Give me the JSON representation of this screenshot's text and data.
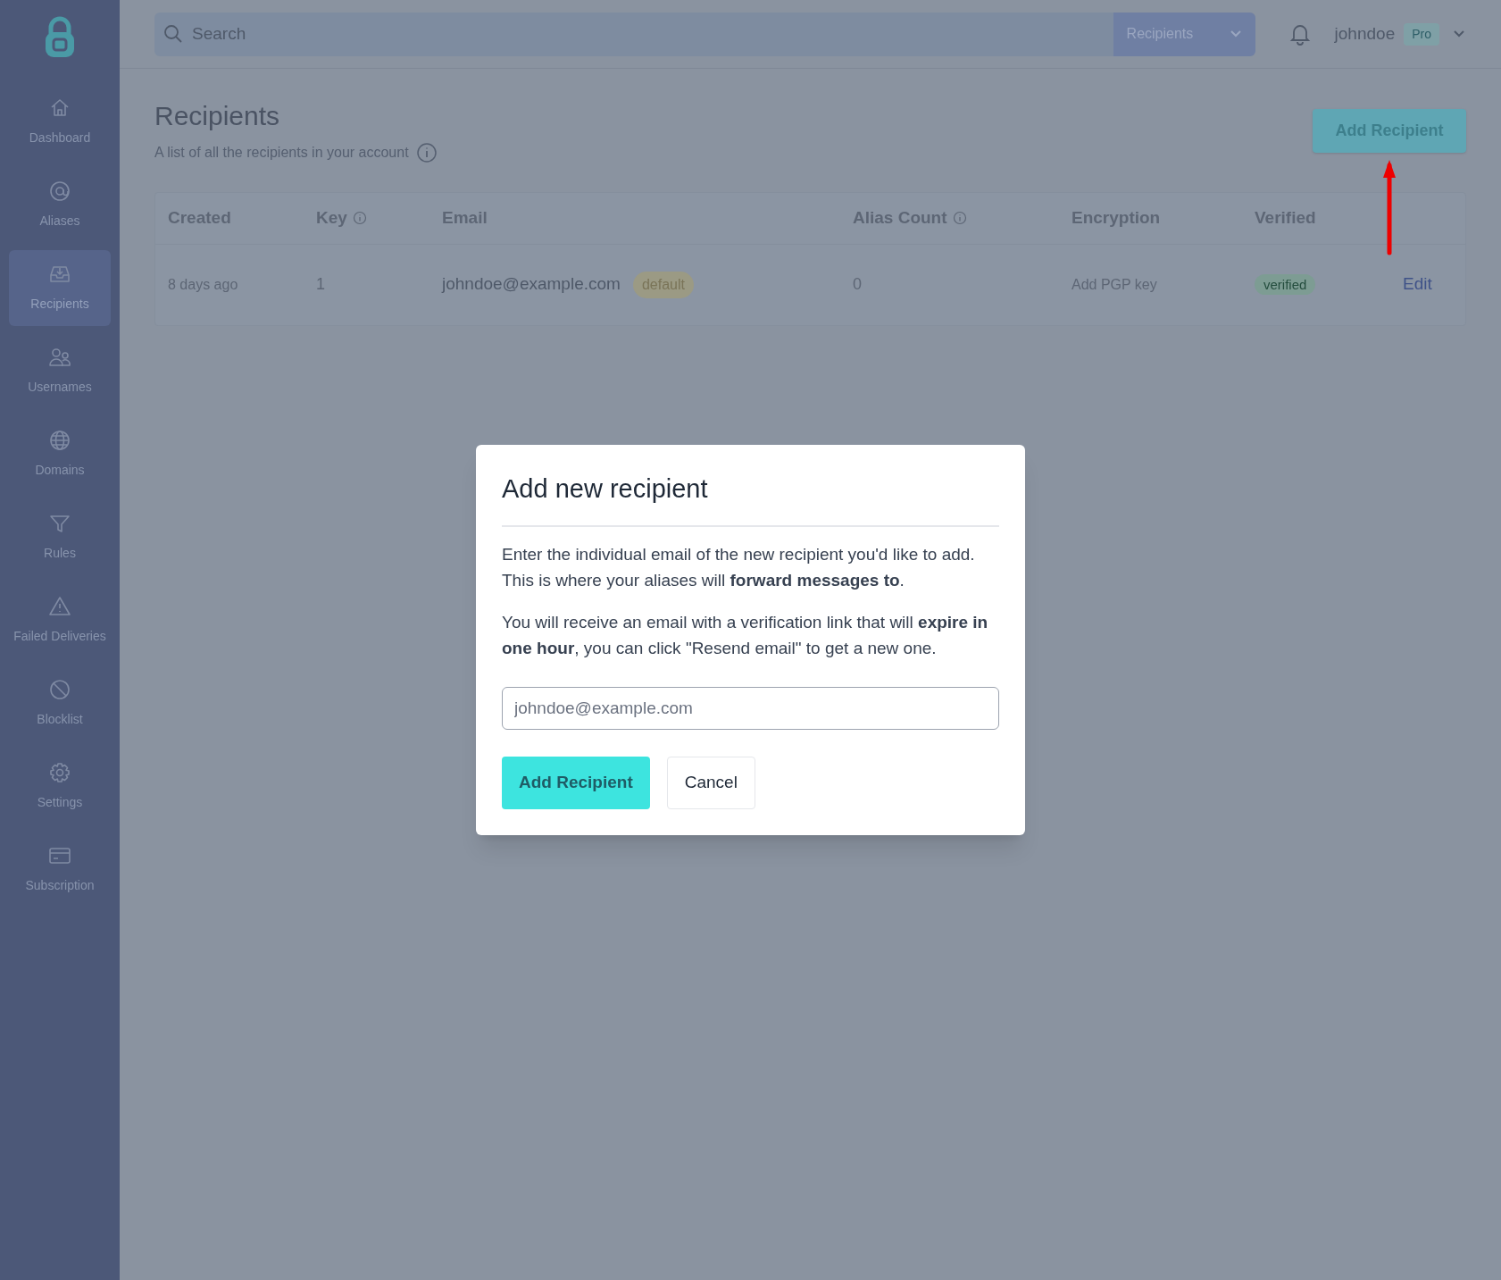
{
  "sidebar": {
    "items": [
      {
        "label": "Dashboard",
        "selected": false
      },
      {
        "label": "Aliases",
        "selected": false
      },
      {
        "label": "Recipients",
        "selected": true
      },
      {
        "label": "Usernames",
        "selected": false
      },
      {
        "label": "Domains",
        "selected": false
      },
      {
        "label": "Rules",
        "selected": false
      },
      {
        "label": "Failed Deliveries",
        "selected": false
      },
      {
        "label": "Blocklist",
        "selected": false
      },
      {
        "label": "Settings",
        "selected": false
      },
      {
        "label": "Subscription",
        "selected": false
      }
    ]
  },
  "top_bar": {
    "search": {
      "placeholder": "Search"
    },
    "scope_dropdown": "Recipients",
    "username": "johndoe",
    "plan_badge": "Pro"
  },
  "page": {
    "title": "Recipients",
    "subtitle": "A list of all the recipients in your account",
    "add_button": "Add Recipient"
  },
  "table": {
    "columns": [
      {
        "label": "Created",
        "info": false
      },
      {
        "label": "Key",
        "info": true
      },
      {
        "label": "Email",
        "info": false
      },
      {
        "label": "Alias Count",
        "info": true
      },
      {
        "label": "Encryption",
        "info": false
      },
      {
        "label": "Verified",
        "info": false
      }
    ],
    "rows": [
      {
        "created": "8 days ago",
        "key": "1",
        "email": "johndoe@example.com",
        "badge": "default",
        "alias_count": "0",
        "encryption": "Add PGP key",
        "verified": "verified",
        "action": "Edit"
      }
    ]
  },
  "modal": {
    "title": "Add new recipient",
    "paragraphs": [
      "Enter the individual email of the new recipient you'd like to add. This is where your aliases will **forward messages to**.",
      "You will receive an email with a verification link that will **expire in one hour**, you can click \"Resend email\" to get a new one."
    ],
    "input": {
      "placeholder": "johndoe@example.com"
    },
    "buttons": [
      {
        "label": "Add Recipient",
        "kind": "primary"
      },
      {
        "label": "Cancel",
        "kind": "secondary"
      }
    ]
  }
}
